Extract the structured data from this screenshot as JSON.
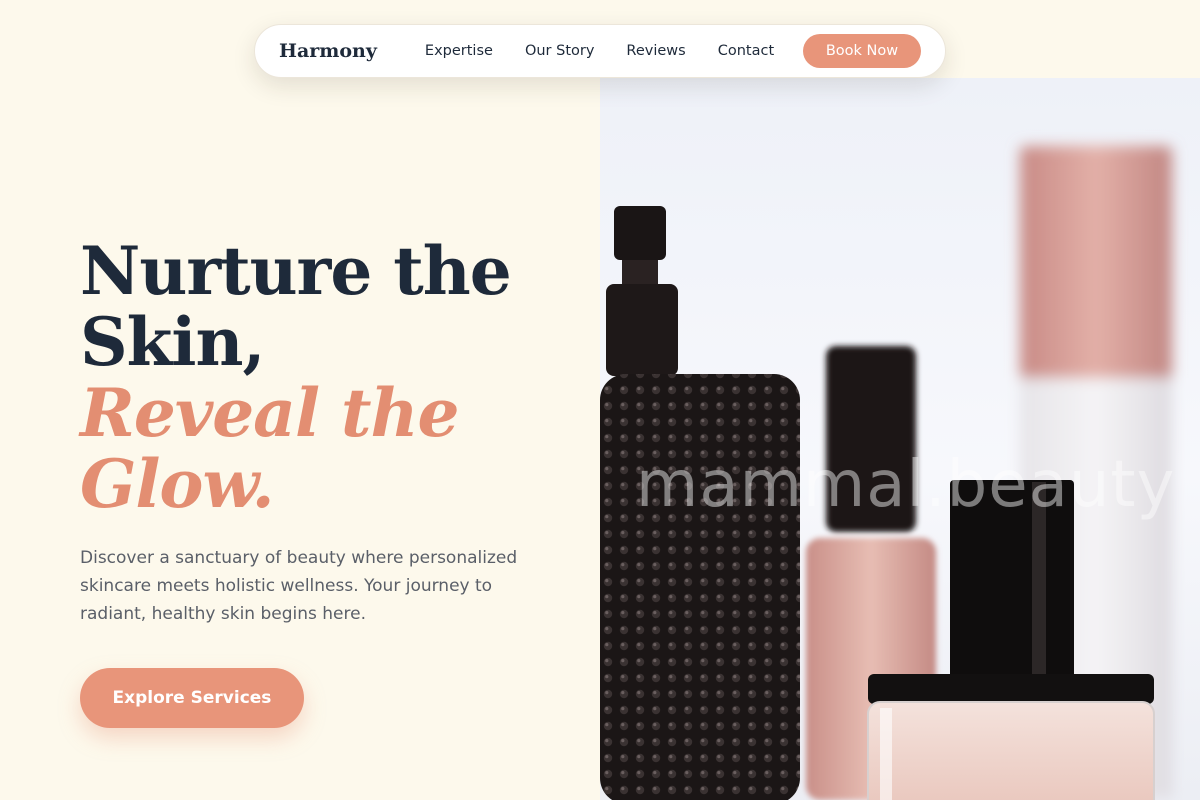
{
  "nav": {
    "brand": "Harmony",
    "links": [
      "Expertise",
      "Our Story",
      "Reviews",
      "Contact"
    ],
    "cta_label": "Book Now"
  },
  "hero": {
    "headline_line1": "Nurture the Skin,",
    "headline_accent": "Reveal the Glow.",
    "subtext": "Discover a sanctuary of beauty where personalized skincare meets holistic wellness. Your journey to radiant, healthy skin begins here.",
    "cta_label": "Explore Services",
    "image_watermark": "mammal.beauty"
  },
  "colors": {
    "background": "#fdf9ec",
    "primary_text": "#1e2a3a",
    "accent": "#e38e72",
    "button": "#e8957a"
  }
}
